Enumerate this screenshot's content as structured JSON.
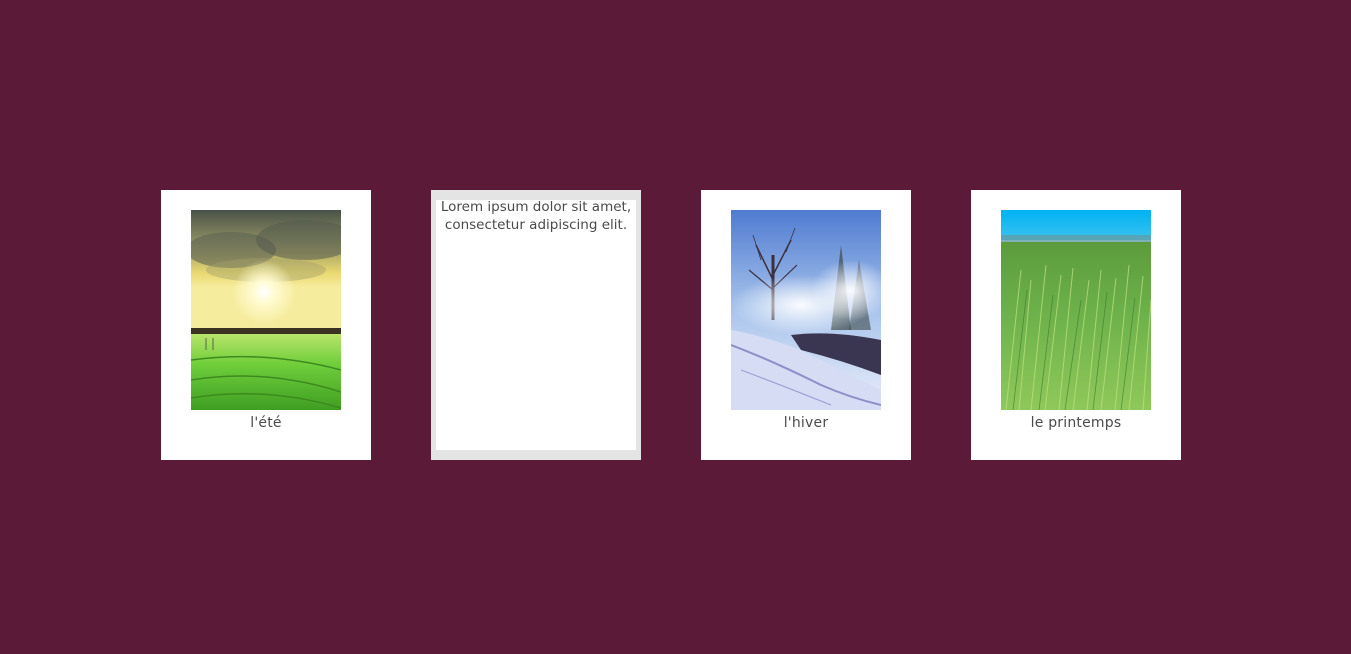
{
  "cards": [
    {
      "caption": "l'été",
      "image": "summer-field-sunset-photo"
    },
    {
      "text": "Lorem ipsum dolor sit amet, consectetur adipiscing elit."
    },
    {
      "caption": "l'hiver",
      "image": "winter-misty-river-photo"
    },
    {
      "caption": "le printemps",
      "image": "spring-wheat-field-photo"
    }
  ],
  "colors": {
    "background": "#5a1a38",
    "card": "#ffffff",
    "active_card_border": "#e4e4e4",
    "caption_text": "#4a4a4a"
  }
}
